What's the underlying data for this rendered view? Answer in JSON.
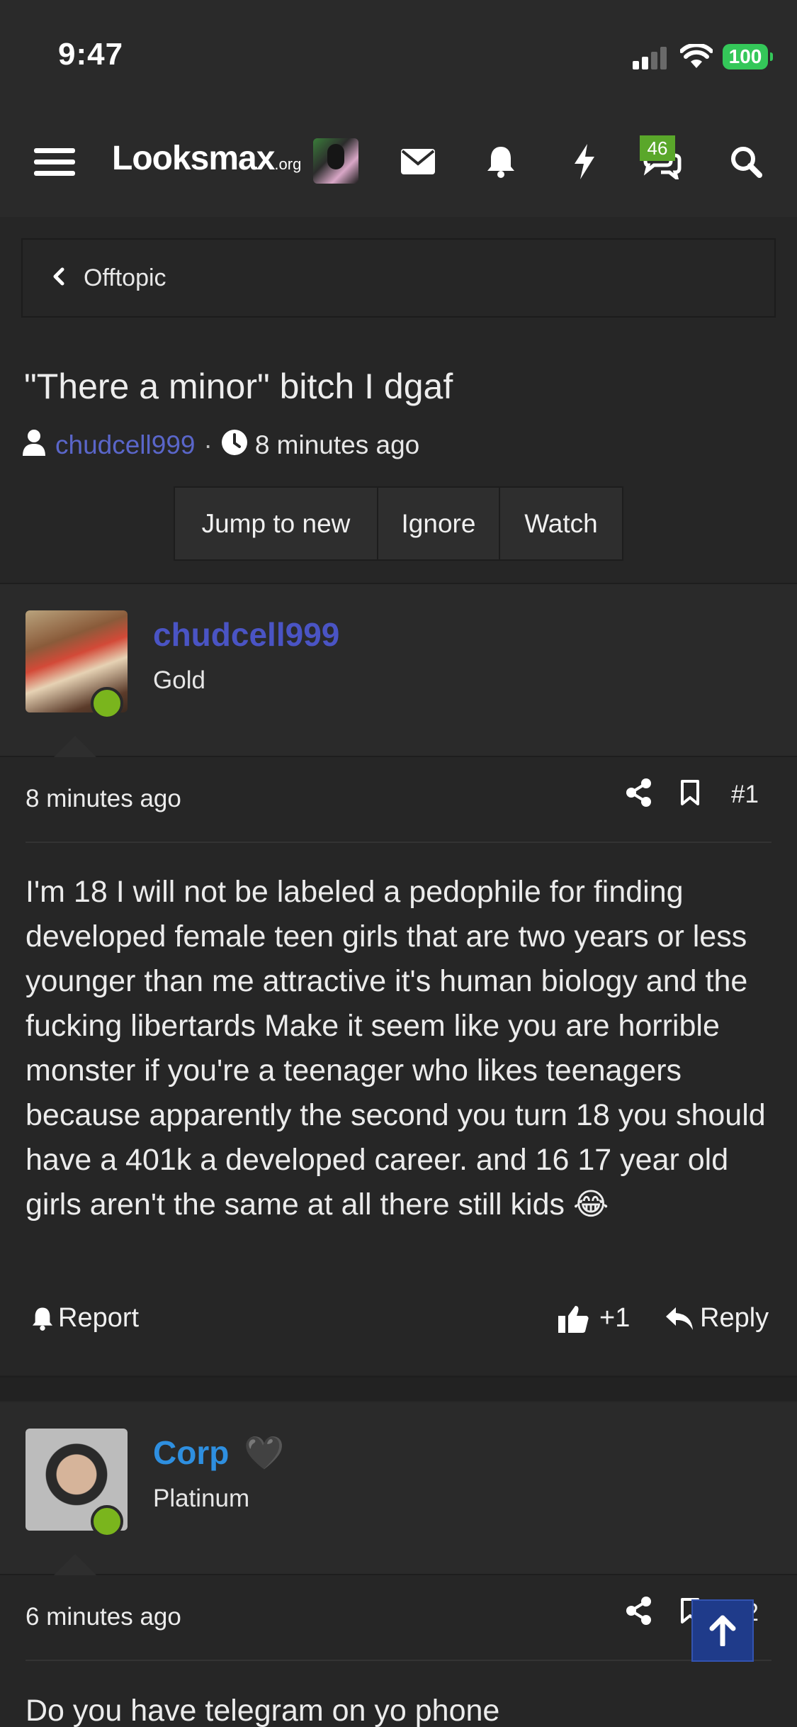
{
  "status_bar": {
    "time": "9:47",
    "battery": "100"
  },
  "nav": {
    "logo_main": "Looksmax",
    "logo_suffix": ".org",
    "chat_badge": "46",
    "icons": [
      "menu-icon",
      "envelope-icon",
      "bell-icon",
      "bolt-icon",
      "chat-icon",
      "search-icon"
    ]
  },
  "breadcrumb": {
    "label": "Offtopic"
  },
  "thread": {
    "title": "\"There a minor\" bitch I dgaf",
    "author": "chudcell999",
    "separator": "·",
    "time_ago": "8 minutes ago",
    "buttons": {
      "jump": "Jump to new",
      "ignore": "Ignore",
      "watch": "Watch"
    }
  },
  "posts": [
    {
      "username": "chudcell999",
      "username_color": "#4a54c4",
      "rank": "Gold",
      "time": "8 minutes ago",
      "number": "#1",
      "body": "I'm 18 I will not be labeled a pedophile for finding developed female teen girls that are two years or less younger than me attractive it's human biology and the fucking libertards Make it seem like you are horrible monster if you're a teenager who likes teenagers because apparently the second you turn 18 you should have a 401k a developed career. and 16 17 year old girls aren't the same at all there still kids",
      "emoji": "😂",
      "report": "Report",
      "likes": "+1",
      "reply": "Reply"
    },
    {
      "username": "Corp",
      "username_color": "#2e8fe0",
      "badge_emoji": "🖤",
      "rank": "Platinum",
      "time": "6 minutes ago",
      "number": "#2",
      "body": "Do you have telegram on yo phone"
    }
  ],
  "colors": {
    "background": "#262626",
    "panel": "#2a2a2a",
    "link": "#5a66c9",
    "online": "#7ab51d",
    "badge": "#5aa72a"
  }
}
